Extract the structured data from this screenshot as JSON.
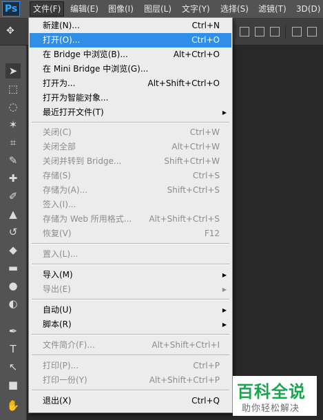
{
  "app": {
    "logo": "Ps"
  },
  "menubar": {
    "items": [
      "文件(F)",
      "编辑(E)",
      "图像(I)",
      "图层(L)",
      "文字(Y)",
      "选择(S)",
      "滤镜(T)",
      "3D(D)"
    ]
  },
  "file_menu": {
    "items": [
      {
        "label": "新建(N)...",
        "shortcut": "Ctrl+N",
        "enabled": true
      },
      {
        "label": "打开(O)...",
        "shortcut": "Ctrl+O",
        "enabled": true,
        "highlighted": true
      },
      {
        "label": "在 Bridge 中浏览(B)...",
        "shortcut": "Alt+Ctrl+O",
        "enabled": true
      },
      {
        "label": "在 Mini Bridge 中浏览(G)...",
        "shortcut": "",
        "enabled": true
      },
      {
        "label": "打开为...",
        "shortcut": "Alt+Shift+Ctrl+O",
        "enabled": true
      },
      {
        "label": "打开为智能对象...",
        "shortcut": "",
        "enabled": true
      },
      {
        "label": "最近打开文件(T)",
        "shortcut": "",
        "enabled": true,
        "submenu": true
      },
      {
        "label": "关闭(C)",
        "shortcut": "Ctrl+W",
        "enabled": false
      },
      {
        "label": "关闭全部",
        "shortcut": "Alt+Ctrl+W",
        "enabled": false
      },
      {
        "label": "关闭并转到 Bridge...",
        "shortcut": "Shift+Ctrl+W",
        "enabled": false
      },
      {
        "label": "存储(S)",
        "shortcut": "Ctrl+S",
        "enabled": false
      },
      {
        "label": "存储为(A)...",
        "shortcut": "Shift+Ctrl+S",
        "enabled": false
      },
      {
        "label": "签入(I)...",
        "shortcut": "",
        "enabled": false
      },
      {
        "label": "存储为 Web 所用格式...",
        "shortcut": "Alt+Shift+Ctrl+S",
        "enabled": false
      },
      {
        "label": "恢复(V)",
        "shortcut": "F12",
        "enabled": false
      },
      {
        "label": "置入(L)...",
        "shortcut": "",
        "enabled": false
      },
      {
        "label": "导入(M)",
        "shortcut": "",
        "enabled": true,
        "submenu": true
      },
      {
        "label": "导出(E)",
        "shortcut": "",
        "enabled": false,
        "submenu": true
      },
      {
        "label": "自动(U)",
        "shortcut": "",
        "enabled": true,
        "submenu": true
      },
      {
        "label": "脚本(R)",
        "shortcut": "",
        "enabled": true,
        "submenu": true
      },
      {
        "label": "文件简介(F)...",
        "shortcut": "Alt+Shift+Ctrl+I",
        "enabled": false
      },
      {
        "label": "打印(P)...",
        "shortcut": "Ctrl+P",
        "enabled": false
      },
      {
        "label": "打印一份(Y)",
        "shortcut": "Alt+Shift+Ctrl+P",
        "enabled": false
      },
      {
        "label": "退出(X)",
        "shortcut": "Ctrl+Q",
        "enabled": true
      }
    ]
  },
  "tools": [
    "move-tool",
    "marquee-tool",
    "lasso-tool",
    "magic-wand-tool",
    "crop-tool",
    "eyedropper-tool",
    "healing-brush-tool",
    "brush-tool",
    "clone-stamp-tool",
    "history-brush-tool",
    "eraser-tool",
    "gradient-tool",
    "blur-tool",
    "dodge-tool",
    "pen-tool",
    "type-tool",
    "path-selection-tool",
    "shape-tool",
    "hand-tool",
    "zoom-tool"
  ],
  "watermark": {
    "title": "百科全说",
    "subtitle": "助你轻松解决"
  },
  "colors": {
    "highlight": "#2f8fe8",
    "menu_bg": "#ececec",
    "chrome": "#535353",
    "workspace": "#282828",
    "watermark_green": "#14a84a"
  }
}
